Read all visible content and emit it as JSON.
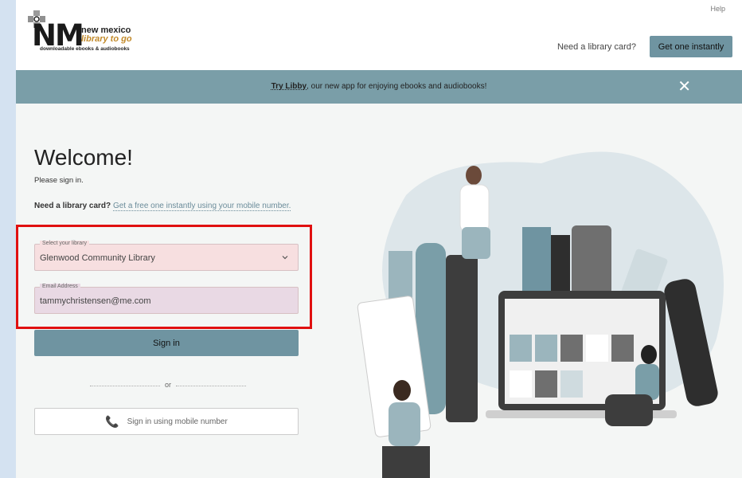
{
  "header": {
    "logo_line1": "new mexico",
    "logo_line2": "library to go",
    "logo_line3": "downloadable ebooks & audiobooks",
    "logo_letters": "NM",
    "help": "Help",
    "need_card": "Need a library card?",
    "get_one": "Get one instantly"
  },
  "banner": {
    "try_libby": "Try Libby",
    "rest": ", our new app for enjoying ebooks and audiobooks!",
    "close": "✕"
  },
  "form": {
    "welcome": "Welcome!",
    "please_sign_in": "Please sign in.",
    "need_card_bold": "Need a library card?",
    "need_card_link": "Get a free one instantly using your mobile number.",
    "library_label": "Select your library",
    "library_value": "Glenwood Community Library",
    "email_label": "Email Address",
    "email_value": "tammychristensen@me.com",
    "sign_in": "Sign in",
    "or": "or",
    "mobile": "Sign in using mobile number"
  },
  "colors": {
    "accent": "#6f94a1",
    "banner": "#7a9ea8",
    "highlight": "#e01010"
  }
}
